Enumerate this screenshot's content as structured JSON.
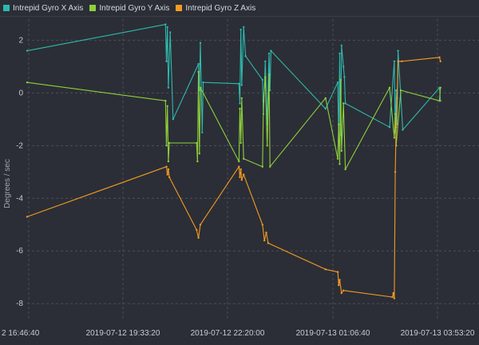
{
  "chart_data": {
    "type": "line",
    "title": "",
    "ylabel": "Degrees / sec",
    "xlabel": "",
    "x_ticks": [
      "2 16:46:40",
      "2019-07-12 19:33:20",
      "2019-07-12 22:20:00",
      "2019-07-13 01:06:40",
      "2019-07-13 03:53:20"
    ],
    "ylim": [
      -8.6,
      2.8
    ],
    "y_ticks": [
      2,
      0,
      -2,
      -4,
      -6,
      -8
    ],
    "grid": true,
    "legend": "top-left",
    "series": [
      {
        "name": "Intrepid Gyro X Axis",
        "color": "#2fb8ad",
        "points": [
          [
            0,
            1.6
          ],
          [
            147,
            2.6
          ],
          [
            148,
            1.2
          ],
          [
            149,
            2.5
          ],
          [
            150,
            0.2
          ],
          [
            152,
            2.3
          ],
          [
            155,
            -1.0
          ],
          [
            182,
            1.1
          ],
          [
            183,
            0.1
          ],
          [
            184,
            1.9
          ],
          [
            186,
            -1.5
          ],
          [
            187,
            0.4
          ],
          [
            225,
            0.35
          ],
          [
            226,
            -0.4
          ],
          [
            227,
            2.4
          ],
          [
            228,
            0.3
          ],
          [
            230,
            2.5
          ],
          [
            232,
            1.4
          ],
          [
            250,
            0.5
          ],
          [
            251,
            -0.8
          ],
          [
            253,
            1.2
          ],
          [
            255,
            -1.2
          ],
          [
            257,
            1.5
          ],
          [
            258,
            0.1
          ],
          [
            259,
            1.6
          ],
          [
            317,
            -0.6
          ],
          [
            330,
            0.4
          ],
          [
            331,
            -1.8
          ],
          [
            332,
            1.5
          ],
          [
            333,
            -1.6
          ],
          [
            334,
            1.8
          ],
          [
            336,
            1.0
          ],
          [
            337,
            0.6
          ],
          [
            338,
            -0.4
          ],
          [
            385,
            -1.3
          ],
          [
            390,
            1.2
          ],
          [
            391,
            -1.5
          ],
          [
            392,
            0.1
          ],
          [
            393,
            -1.2
          ],
          [
            394,
            1.6
          ],
          [
            399,
            -1.4
          ],
          [
            438,
            0.2
          ],
          [
            439,
            -0.3
          ]
        ]
      },
      {
        "name": "Intrepid Gyro Y Axis",
        "color": "#8fcf3c",
        "points": [
          [
            0,
            0.4
          ],
          [
            147,
            -0.3
          ],
          [
            148,
            -2.0
          ],
          [
            149,
            -0.5
          ],
          [
            150,
            -2.6
          ],
          [
            151,
            -1.9
          ],
          [
            180,
            -1.9
          ],
          [
            181,
            -2.6
          ],
          [
            182,
            0.8
          ],
          [
            183,
            -2.3
          ],
          [
            184,
            0.2
          ],
          [
            225,
            -2.6
          ],
          [
            226,
            -0.6
          ],
          [
            227,
            -1.9
          ],
          [
            228,
            -0.2
          ],
          [
            230,
            -2.5
          ],
          [
            250,
            -2.8
          ],
          [
            251,
            -0.3
          ],
          [
            253,
            0.6
          ],
          [
            255,
            -2.0
          ],
          [
            257,
            0.7
          ],
          [
            258,
            -2.8
          ],
          [
            317,
            -0.2
          ],
          [
            330,
            -2.5
          ],
          [
            331,
            -1.2
          ],
          [
            332,
            -2.7
          ],
          [
            333,
            0.5
          ],
          [
            334,
            -2.2
          ],
          [
            336,
            -0.4
          ],
          [
            338,
            -2.9
          ],
          [
            385,
            0.2
          ],
          [
            390,
            -1.7
          ],
          [
            391,
            -0.8
          ],
          [
            392,
            -2.0
          ],
          [
            397,
            0.1
          ],
          [
            438,
            -0.3
          ],
          [
            439,
            0.2
          ]
        ]
      },
      {
        "name": "Intrepid Gyro Z Axis",
        "color": "#f39a23",
        "points": [
          [
            0,
            -4.7
          ],
          [
            148,
            -2.8
          ],
          [
            149,
            -3.1
          ],
          [
            150,
            -2.9
          ],
          [
            151,
            -3.2
          ],
          [
            180,
            -5.2
          ],
          [
            182,
            -5.5
          ],
          [
            184,
            -5.0
          ],
          [
            225,
            -2.8
          ],
          [
            226,
            -3.2
          ],
          [
            227,
            -2.9
          ],
          [
            228,
            -3.3
          ],
          [
            230,
            -3.1
          ],
          [
            250,
            -5.0
          ],
          [
            252,
            -5.6
          ],
          [
            254,
            -5.3
          ],
          [
            256,
            -5.7
          ],
          [
            317,
            -6.7
          ],
          [
            330,
            -6.8
          ],
          [
            331,
            -7.3
          ],
          [
            332,
            -7.1
          ],
          [
            334,
            -7.6
          ],
          [
            336,
            -7.5
          ],
          [
            388,
            -7.75
          ],
          [
            389,
            -7.6
          ],
          [
            390,
            -7.8
          ],
          [
            391,
            -3.0
          ],
          [
            392,
            -1.3
          ],
          [
            393,
            -0.2
          ],
          [
            394,
            1.2
          ],
          [
            398,
            1.2
          ],
          [
            438,
            1.35
          ],
          [
            439,
            1.2
          ]
        ]
      }
    ]
  }
}
